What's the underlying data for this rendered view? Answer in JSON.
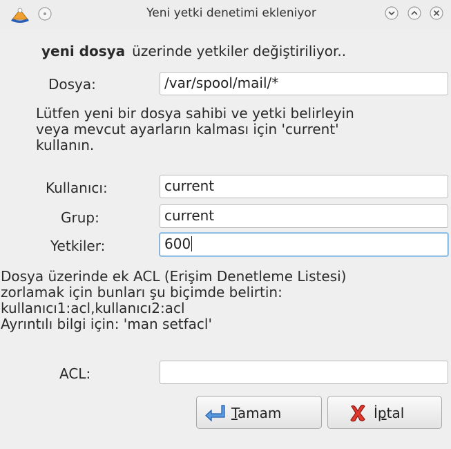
{
  "window": {
    "title": "Yeni yetki denetimi ekleniyor"
  },
  "heading": {
    "filename": "yeni dosya",
    "text": "üzerinde yetkiler değiştiriliyor.."
  },
  "file_field": {
    "label": "Dosya:",
    "value": "/var/spool/mail/*"
  },
  "instructions": {
    "line1": "Lütfen yeni bir dosya sahibi ve yetki belirleyin",
    "line2": "veya mevcut ayarların kalması için 'current'",
    "line3": "kullanın."
  },
  "user_field": {
    "label": "Kullanıcı:",
    "value": "current"
  },
  "group_field": {
    "label": "Grup:",
    "value": "current"
  },
  "perms_field": {
    "label": "Yetkiler:",
    "value": "600"
  },
  "acl_help": {
    "line1": "Dosya üzerinde ek ACL (Erişim Denetleme Listesi)",
    "line2": "zorlamak için bunları şu biçimde belirtin:",
    "line3": "kullanıcı1:acl,kullanıcı2:acl",
    "line4": "Ayrıntılı bilgi için: 'man setfacl'"
  },
  "acl_field": {
    "label": "ACL:",
    "value": ""
  },
  "buttons": {
    "ok_mnemonic": "T",
    "ok_rest": "amam",
    "cancel_start": "İ",
    "cancel_mnemonic": "p",
    "cancel_rest": "tal"
  },
  "icons": {
    "app": "app-icon",
    "ok": "return-arrow-icon",
    "cancel": "red-x-icon"
  },
  "colors": {
    "background": "#efefef",
    "focus": "#63a3d6",
    "cancel_icon": "#d9302b",
    "ok_icon": "#4a90d9"
  }
}
